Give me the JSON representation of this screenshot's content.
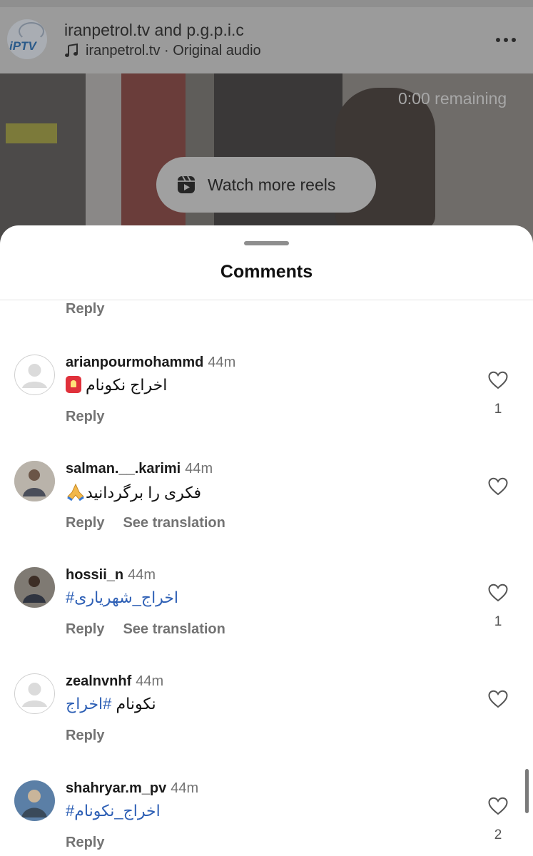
{
  "reel": {
    "title": "iranpetrol.tv and p.g.p.i.c",
    "audio": "iranpetrol.tv · Original audio",
    "avatar_logo": "iPTV",
    "remaining": "0:00 remaining",
    "watch_more_label": "Watch more reels"
  },
  "sheet": {
    "title": "Comments",
    "top_reply": "Reply"
  },
  "comments": [
    {
      "username": "arianpourmohammd",
      "time": "44m",
      "text": "اخراج نکونام",
      "reply": "Reply",
      "see_translation": "",
      "likes": "1"
    },
    {
      "username": "salman.__.karimi",
      "time": "44m",
      "text": "فکری را برگردانید",
      "reply": "Reply",
      "see_translation": "See translation",
      "likes": ""
    },
    {
      "username": "hossii_n",
      "time": "44m",
      "text": "#اخراج_شهریاری",
      "reply": "Reply",
      "see_translation": "See translation",
      "likes": "1"
    },
    {
      "username": "zealnvnhf",
      "time": "44m",
      "text_plain": "نکونام",
      "text_tag": "#اخراج",
      "reply": "Reply",
      "see_translation": "",
      "likes": ""
    },
    {
      "username": "shahryar.m_pv",
      "time": "44m",
      "text": "#اخراج_نکونام",
      "reply": "Reply",
      "see_translation": "",
      "likes": "2"
    }
  ],
  "icons": {
    "music": "music-note-icon",
    "more": "more-horizontal-icon",
    "reels": "reels-icon",
    "heart": "heart-outline-icon"
  }
}
